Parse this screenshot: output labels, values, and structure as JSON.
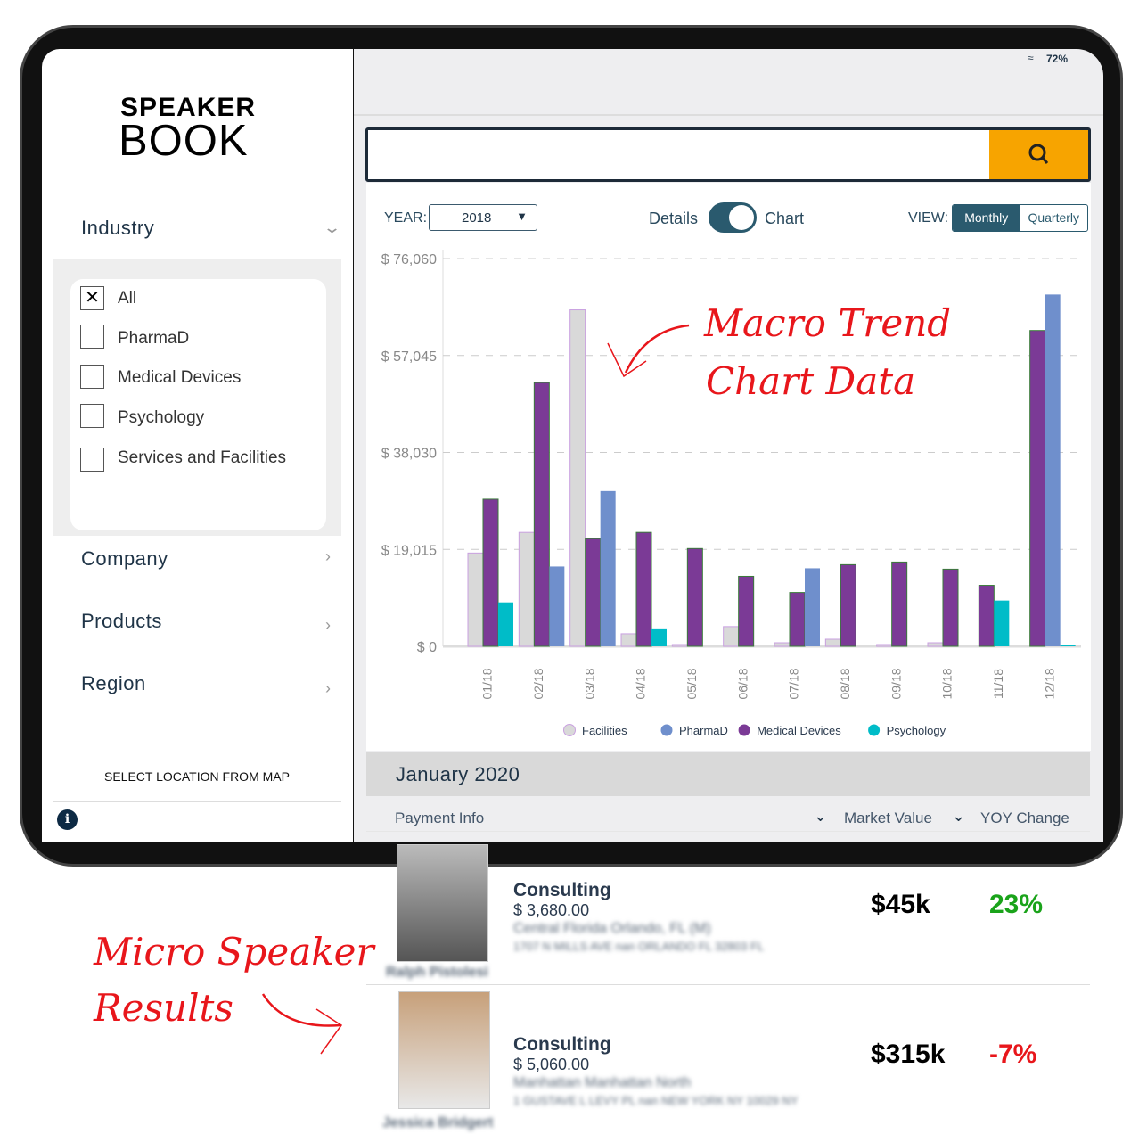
{
  "status_bar": {
    "battery": "72%"
  },
  "sidebar": {
    "logo_top": "SPEAKER",
    "logo_bottom": "BOOK",
    "industry": {
      "label": "Industry",
      "options": [
        {
          "label": "All",
          "checked": true
        },
        {
          "label": "PharmaD",
          "checked": false
        },
        {
          "label": "Medical Devices",
          "checked": false
        },
        {
          "label": "Psychology",
          "checked": false
        },
        {
          "label": "Services and Facilities",
          "checked": false
        }
      ]
    },
    "company": "Company",
    "products": "Products",
    "region": "Region",
    "map_link": "SELECT LOCATION FROM MAP"
  },
  "search": {
    "placeholder": ""
  },
  "controls": {
    "year_label": "YEAR:",
    "year_value": "2018",
    "details": "Details",
    "chart": "Chart",
    "toggle_on": true,
    "view_label": "VIEW:",
    "monthly": "Monthly",
    "quarterly": "Quarterly",
    "selected_view": "Monthly"
  },
  "annotations": {
    "macro1": "Macro Trend",
    "macro2": "Chart Data",
    "micro1": "Micro Speaker",
    "micro2": "Results"
  },
  "chart_data": {
    "type": "bar",
    "categories": [
      "01/18",
      "02/18",
      "03/18",
      "04/18",
      "05/18",
      "06/18",
      "07/18",
      "08/18",
      "09/18",
      "10/18",
      "11/18",
      "12/18"
    ],
    "y_ticks": [
      "$ 0",
      "$ 19,015",
      "$ 38,030",
      "$ 57,045",
      "$ 76,060"
    ],
    "ylim": [
      0,
      76060
    ],
    "grid": true,
    "legend_position": "bottom",
    "series": [
      {
        "name": "Facilities",
        "color": "#d9d9d9",
        "values": [
          18300,
          22350,
          66000,
          2460,
          350,
          3870,
          700,
          1400,
          350,
          700,
          0,
          0
        ]
      },
      {
        "name": "Medical Devices",
        "color": "#7b3a96",
        "values": [
          28860,
          51740,
          21120,
          22350,
          19180,
          13730,
          10560,
          16020,
          16540,
          15140,
          11970,
          61950
        ]
      },
      {
        "name": "PharmaD",
        "color": "#6f8fcc",
        "values": [
          0,
          15660,
          30450,
          0,
          0,
          0,
          15310,
          0,
          0,
          0,
          0,
          69000
        ]
      },
      {
        "name": "Psychology",
        "color": "#00bcc8",
        "values": [
          8620,
          0,
          0,
          3520,
          0,
          0,
          0,
          0,
          0,
          0,
          8980,
          350
        ]
      }
    ]
  },
  "list": {
    "month": "January 2020",
    "headers": {
      "payment": "Payment Info",
      "market": "Market Value",
      "yoy": "YOY Change"
    },
    "rows": [
      {
        "name": "Ralph Pistolesi",
        "type": "Consulting",
        "amount": "$ 3,680.00",
        "location": "Central Florida Orlando, FL (M)",
        "address": "1707 N MILLS AVE nan ORLANDO FL 32803 FL",
        "market_value": "$45k",
        "yoy": "23%",
        "yoy_color": "#1aa31a"
      },
      {
        "name": "Jessica Bridgert",
        "type": "Consulting",
        "amount": "$ 5,060.00",
        "location": "Manhattan Manhattan North",
        "address": "1 GUSTAVE L LEVY PL nan NEW YORK NY 10029 NY",
        "market_value": "$315k",
        "yoy": "-7%",
        "yoy_color": "#e8161b"
      }
    ]
  }
}
